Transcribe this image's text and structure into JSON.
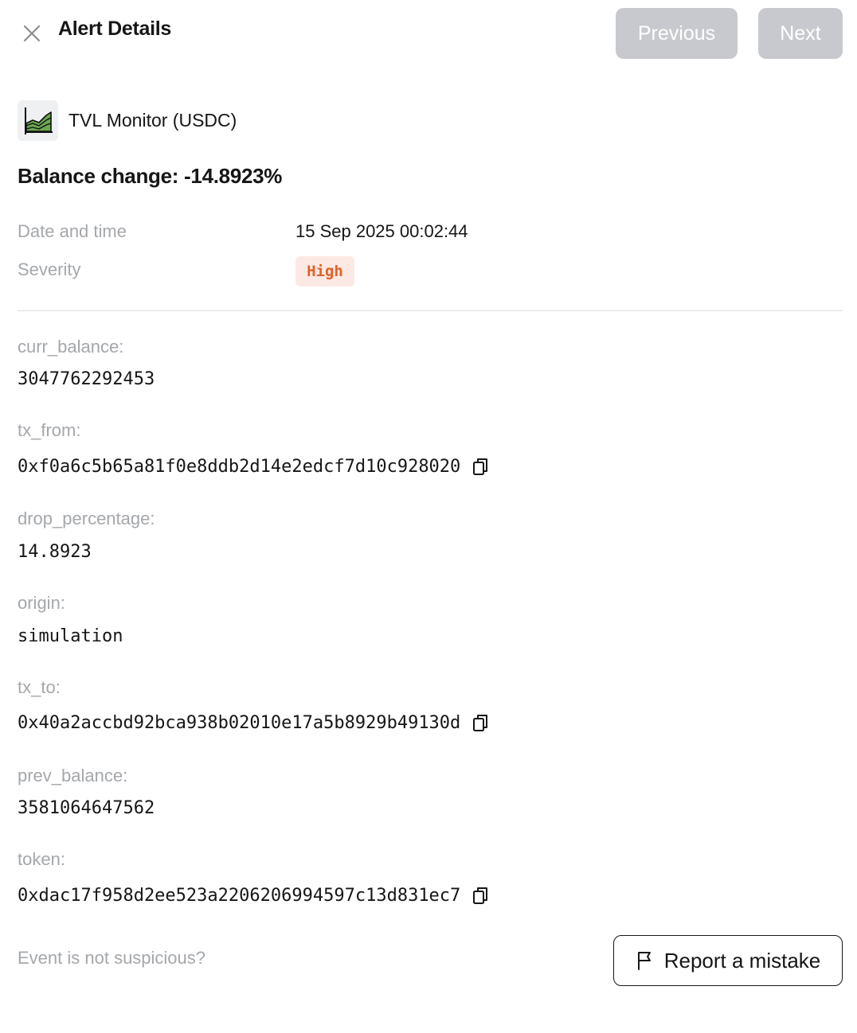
{
  "header": {
    "title": "Alert Details",
    "previous_label": "Previous",
    "next_label": "Next"
  },
  "monitor": {
    "name": "TVL Monitor (USDC)",
    "icon": "area-chart-icon"
  },
  "balance_change_title": "Balance change: -14.8923%",
  "meta": {
    "date_label": "Date and time",
    "date_value": "15 Sep 2025 00:02:44",
    "severity_label": "Severity",
    "severity_value": "High"
  },
  "fields": [
    {
      "label": "curr_balance:",
      "value": "3047762292453",
      "copyable": false
    },
    {
      "label": "tx_from:",
      "value": "0xf0a6c5b65a81f0e8ddb2d14e2edcf7d10c928020",
      "copyable": true
    },
    {
      "label": "drop_percentage:",
      "value": "14.8923",
      "copyable": false
    },
    {
      "label": "origin:",
      "value": "simulation",
      "copyable": false
    },
    {
      "label": "tx_to:",
      "value": "0x40a2accbd92bca938b02010e17a5b8929b49130d",
      "copyable": true
    },
    {
      "label": "prev_balance:",
      "value": "3581064647562",
      "copyable": false
    },
    {
      "label": "token:",
      "value": "0xdac17f958d2ee523a2206206994597c13d831ec7",
      "copyable": true
    }
  ],
  "footer": {
    "question": "Event is not suspicious?",
    "report_label": "Report a mistake"
  },
  "colors": {
    "severity_high_bg": "#fde9e3",
    "severity_high_text": "#e2622a",
    "disabled_button": "#c8c9ce",
    "muted_text": "#a4a7ab"
  }
}
